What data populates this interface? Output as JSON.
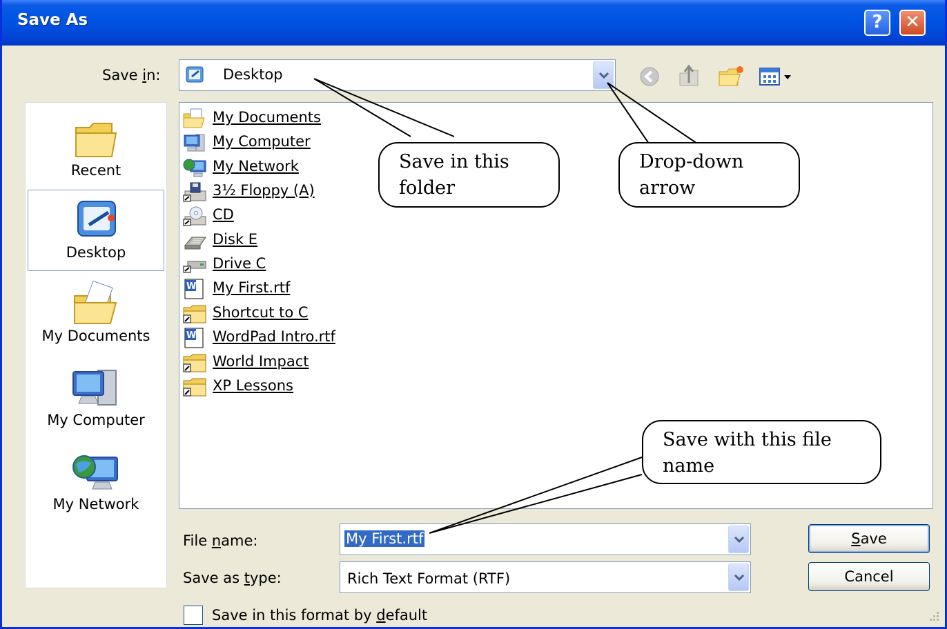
{
  "window": {
    "title": "Save As"
  },
  "titlebar": {
    "help_label": "?",
    "close_label": "✕"
  },
  "save_in": {
    "label_prefix": "Save ",
    "label_accel": "i",
    "label_suffix": "n:",
    "value": "Desktop"
  },
  "toolbar": {
    "icons": [
      "back-icon",
      "up-folder-icon",
      "new-folder-icon",
      "views-menu-icon"
    ]
  },
  "places": [
    {
      "label": "Recent",
      "icon": "recent-folder-icon",
      "selected": false
    },
    {
      "label": "Desktop",
      "icon": "desktop-icon",
      "selected": true
    },
    {
      "label": "My Documents",
      "icon": "my-documents-icon",
      "selected": false
    },
    {
      "label": "My Computer",
      "icon": "my-computer-icon",
      "selected": false
    },
    {
      "label": "My Network",
      "icon": "my-network-icon",
      "selected": false
    }
  ],
  "files": [
    {
      "name": "My Documents",
      "icon": "my-documents-icon"
    },
    {
      "name": "My Computer",
      "icon": "my-computer-icon"
    },
    {
      "name": "My Network",
      "icon": "my-network-icon"
    },
    {
      "name": "3½ Floppy (A)",
      "icon": "floppy-drive-icon"
    },
    {
      "name": "CD",
      "icon": "cd-drive-icon"
    },
    {
      "name": "Disk E",
      "icon": "removable-disk-icon"
    },
    {
      "name": "Drive C",
      "icon": "hard-drive-icon"
    },
    {
      "name": "My First.rtf",
      "icon": "rtf-document-icon"
    },
    {
      "name": "Shortcut to C",
      "icon": "folder-shortcut-icon"
    },
    {
      "name": "WordPad Intro.rtf",
      "icon": "rtf-document-icon"
    },
    {
      "name": "World Impact",
      "icon": "folder-shortcut-icon"
    },
    {
      "name": "XP Lessons",
      "icon": "folder-shortcut-icon"
    }
  ],
  "file_name": {
    "label_prefix": "File ",
    "label_accel": "n",
    "label_suffix": "ame:",
    "value": "My First.rtf"
  },
  "save_type": {
    "label_prefix": "Save as ",
    "label_accel": "t",
    "label_suffix": "ype:",
    "value": "Rich Text Format (RTF)"
  },
  "buttons": {
    "save_accel": "S",
    "save_rest": "ave",
    "cancel": "Cancel"
  },
  "checkbox": {
    "label_prefix": "Save in this format by ",
    "label_accel": "d",
    "label_suffix": "efault",
    "checked": false
  },
  "callouts": {
    "save_in_folder": "Save in this folder",
    "dropdown_arrow": "Drop-down arrow",
    "file_name": "Save with this file name"
  },
  "colors": {
    "title_bar": "#0054e3",
    "dialog_bg": "#ece9d8",
    "selection": "#316ac5",
    "close_button": "#d04a24"
  }
}
